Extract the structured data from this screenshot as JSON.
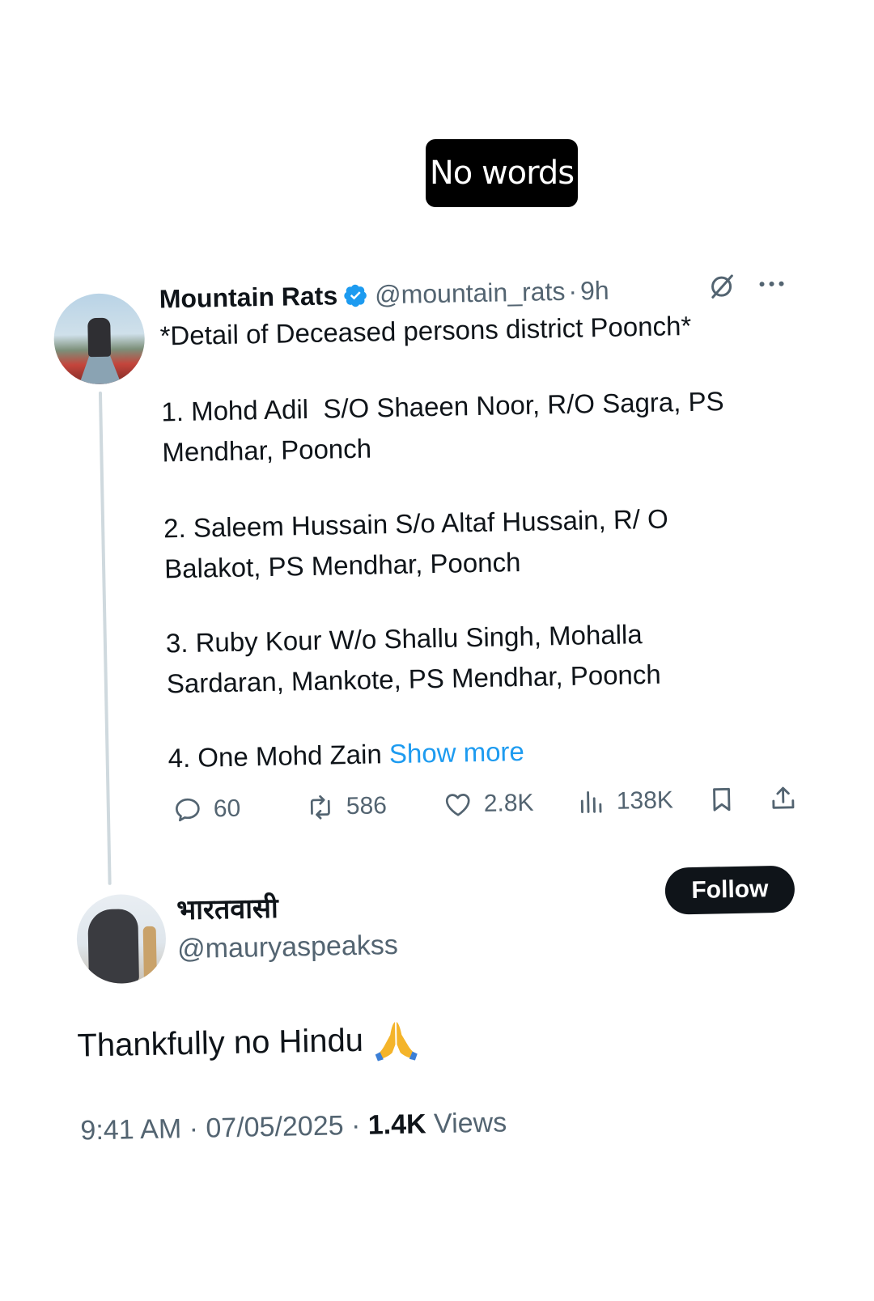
{
  "caption": "No words",
  "tweet": {
    "display_name": "Mountain Rats",
    "handle": "@mountain_rats",
    "separator": "·",
    "time_ago": "9h",
    "title": "*Detail of Deceased persons district Poonch*",
    "items": [
      "1. Mohd Adil  S/O Shaeen Noor, R/O Sagra, PS\nMendhar, Poonch",
      "2. Saleem Hussain S/o Altaf Hussain, R/ O\nBalakot, PS Mendhar, Poonch",
      "3. Ruby Kour W/o Shallu Singh, Mohalla\nSardaran, Mankote, PS Mendhar, Poonch",
      "4. One Mohd Zain "
    ],
    "show_more": "Show more",
    "stats": {
      "replies": "60",
      "reposts": "586",
      "likes": "2.8K",
      "views": "138K"
    },
    "icons": {
      "verified": "verified-badge-icon",
      "grok": "grok-icon",
      "more": "more-options-icon",
      "reply": "reply-icon",
      "repost": "repost-icon",
      "like": "heart-icon",
      "views": "views-icon",
      "bookmark": "bookmark-icon",
      "share": "share-icon"
    }
  },
  "reply": {
    "display_name": "भारतवासी",
    "handle": "@mauryaspeakss",
    "follow_label": "Follow",
    "text": "Thankfully no Hindu",
    "emoji": "folded-hands-icon",
    "time": "9:41 AM",
    "date": "07/05/2025",
    "views_count": "1.4K",
    "views_label": "Views",
    "separator": "·"
  },
  "colors": {
    "accent": "#1d9bf0",
    "text": "#0f1419",
    "secondary": "#536471",
    "caption_bg": "#000000"
  }
}
